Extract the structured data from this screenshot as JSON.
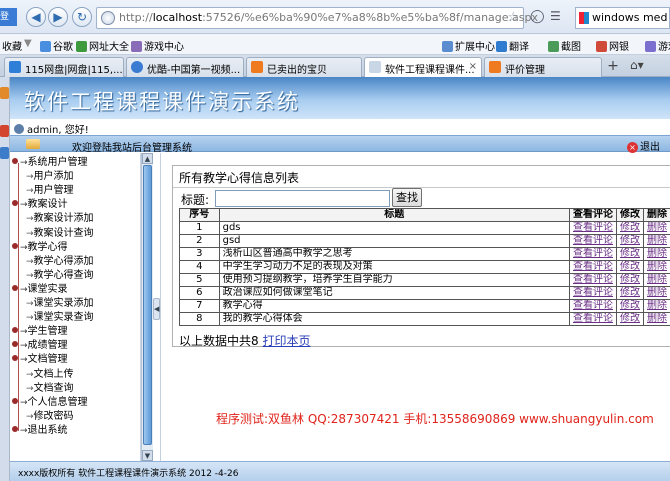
{
  "browser": {
    "left_badge": "登录",
    "url_host": "localhost",
    "url_rest": ":57526/%e6%ba%90%e7%a8%8b%e5%ba%8f/manage.aspx",
    "url_prefix": "http://",
    "search_text": "windows med"
  },
  "favorites": {
    "collect_label": "收藏",
    "items": [
      "谷歌",
      "网址大全",
      "游戏中心"
    ],
    "right_items": [
      "扩展中心",
      "翻译",
      "截图",
      "网银",
      "游戏"
    ]
  },
  "tabs": [
    {
      "label": "115网盘|网盘|115,...",
      "active": false,
      "color": "#2f7ed8"
    },
    {
      "label": "优酷-中国第一视频...",
      "active": false,
      "color": "#3b7bd1"
    },
    {
      "label": "已卖出的宝贝",
      "active": false,
      "color": "#f07a20"
    },
    {
      "label": "软件工程课程课件...",
      "active": true,
      "color": "#c9d6e6"
    },
    {
      "label": "评价管理",
      "active": false,
      "color": "#f07a20"
    }
  ],
  "header": {
    "title": "软件工程课程课件演示系统",
    "user_text": "admin, 您好!",
    "welcome_text": "欢迎登陆我站后台管理系统",
    "exit_label": "退出"
  },
  "menu": {
    "items": [
      {
        "label": "系统用户管理",
        "level": 1
      },
      {
        "label": "用户添加",
        "level": 2
      },
      {
        "label": "用户管理",
        "level": 2
      },
      {
        "label": "教案设计",
        "level": 1
      },
      {
        "label": "教案设计添加",
        "level": 2
      },
      {
        "label": "教案设计查询",
        "level": 2
      },
      {
        "label": "教学心得",
        "level": 1
      },
      {
        "label": "教学心得添加",
        "level": 2
      },
      {
        "label": "教学心得查询",
        "level": 2
      },
      {
        "label": "课堂实录",
        "level": 1
      },
      {
        "label": "课堂实录添加",
        "level": 2
      },
      {
        "label": "课堂实录查询",
        "level": 2
      },
      {
        "label": "学生管理",
        "level": 1
      },
      {
        "label": "成绩管理",
        "level": 1
      },
      {
        "label": "文档管理",
        "level": 1
      },
      {
        "label": "文档上传",
        "level": 2
      },
      {
        "label": "文档查询",
        "level": 2
      },
      {
        "label": "个人信息管理",
        "level": 1
      },
      {
        "label": "修改密码",
        "level": 2
      },
      {
        "label": "退出系统",
        "level": 1
      }
    ]
  },
  "main": {
    "panel_title": "所有教学心得信息列表",
    "search_label": "标题:",
    "search_value": "",
    "search_button": "查找",
    "columns": [
      "序号",
      "标题",
      "查看评论",
      "修改",
      "删除"
    ],
    "rows": [
      {
        "no": "1",
        "title": "gds",
        "view": "查看评论",
        "edit": "修改",
        "del": "删除"
      },
      {
        "no": "2",
        "title": "gsd",
        "view": "查看评论",
        "edit": "修改",
        "del": "删除"
      },
      {
        "no": "3",
        "title": "浅析山区普通高中教学之思考",
        "view": "查看评论",
        "edit": "修改",
        "del": "删除"
      },
      {
        "no": "4",
        "title": "中学生学习动力不足的表现及对策",
        "view": "查看评论",
        "edit": "修改",
        "del": "删除"
      },
      {
        "no": "5",
        "title": "使用预习提纲教学，培养学生自学能力",
        "view": "查看评论",
        "edit": "修改",
        "del": "删除"
      },
      {
        "no": "6",
        "title": "政治课应如何做课堂笔记",
        "view": "查看评论",
        "edit": "修改",
        "del": "删除"
      },
      {
        "no": "7",
        "title": "教学心得",
        "view": "查看评论",
        "edit": "修改",
        "del": "删除"
      },
      {
        "no": "8",
        "title": "我的教学心得体会",
        "view": "查看评论",
        "edit": "修改",
        "del": "删除"
      }
    ],
    "summary_text": "以上数据中共8",
    "print_link": "打印本页",
    "tester_text": "程序测试:双鱼林 QQ:287307421 手机:13558690869 www.shuangyulin.com"
  },
  "footer": {
    "text": "xxxx版权所有  软件工程课程课件演示系统  2012 -4-26"
  },
  "colors": {
    "banner": "#4a86c6",
    "tester": "#e0231b",
    "link": "#6a2f86"
  }
}
